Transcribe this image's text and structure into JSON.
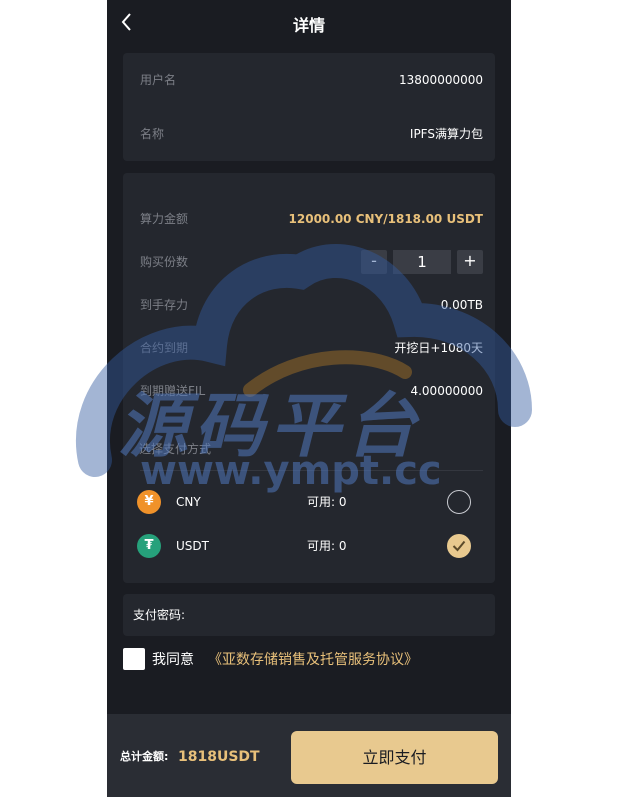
{
  "header": {
    "title": "详情"
  },
  "info": {
    "username_label": "用户名",
    "username_value": "13800000000",
    "name_label": "名称",
    "name_value": "IPFS满算力包"
  },
  "detail": {
    "price_label": "算力金额",
    "price_value": "12000.00 CNY/1818.00 USDT",
    "qty_label": "购买份数",
    "qty_value": "1",
    "qty_minus": "-",
    "qty_plus": "+",
    "storage_label": "到手存力",
    "storage_value": "0.00TB",
    "expire_label": "合约到期",
    "expire_value": "开挖日+1080天",
    "fil_label": "到期赠送FIL",
    "fil_value": "4.00000000"
  },
  "payment": {
    "title": "选择支付方式",
    "methods": [
      {
        "symbol": "¥",
        "name": "CNY",
        "available": "可用: 0",
        "selected": false
      },
      {
        "symbol": "₮",
        "name": "USDT",
        "available": "可用: 0",
        "selected": true
      }
    ]
  },
  "password": {
    "label": "支付密码:"
  },
  "agreement": {
    "text": "我同意",
    "link": "《亚数存储销售及托管服务协议》"
  },
  "footer": {
    "total_label": "总计金额:",
    "total_value": "1818USDT",
    "pay_button": "立即支付"
  },
  "watermark": {
    "brand": "源码平台",
    "url": "www.ympt.cc"
  },
  "colors": {
    "accent": "#e8c07a",
    "button": "#e8c98f",
    "background": "#1a1c22",
    "card": "#24272e"
  }
}
